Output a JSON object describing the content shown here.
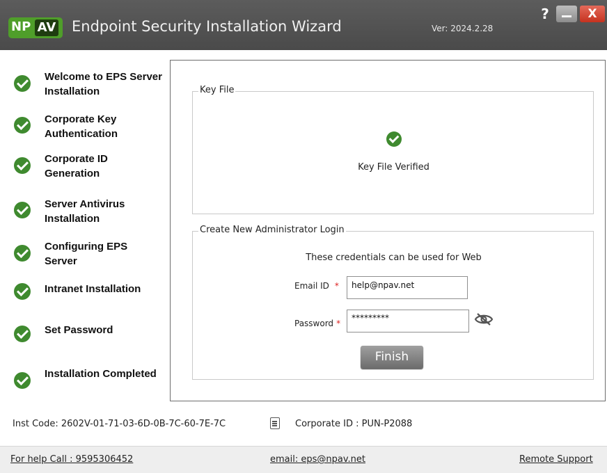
{
  "titlebar": {
    "logo_np": "NP",
    "logo_av": "AV",
    "title": "Endpoint Security Installation Wizard",
    "version": "Ver: 2024.2.28",
    "help_label": "?",
    "close_label": "X"
  },
  "steps": [
    {
      "label": "Welcome to EPS Server Installation",
      "status": "completed"
    },
    {
      "label": "Corporate Key Authentication",
      "status": "completed"
    },
    {
      "label": "Corporate ID Generation",
      "status": "completed"
    },
    {
      "label": "Server Antivirus Installation",
      "status": "completed"
    },
    {
      "label": "Configuring EPS Server",
      "status": "completed"
    },
    {
      "label": "Intranet Installation",
      "status": "completed"
    },
    {
      "label": "Set Password",
      "status": "completed"
    },
    {
      "label": "Installation Completed",
      "status": "completed"
    }
  ],
  "key_file": {
    "legend": "Key File",
    "status_text": "Key File Verified"
  },
  "admin_login": {
    "legend": "Create New Administrator Login",
    "note": "These credentials can be used for Web",
    "email_label": "Email ID",
    "email_value": "help@npav.net",
    "password_label": "Password",
    "password_value": "*********",
    "required_marker": "*",
    "finish_label": "Finish"
  },
  "info": {
    "inst_code": "Inst Code: 2602V-01-71-03-6D-0B-7C-60-7E-7C",
    "corporate_id": "Corporate ID : PUN-P2088"
  },
  "footer": {
    "help_call": "For help Call : 9595306452",
    "email": "email: eps@npav.net",
    "remote_support": "Remote Support"
  },
  "colors": {
    "titlebar": "#505050",
    "logo_green": "#4f9e2a",
    "check_green": "#3f8a2f",
    "close_red": "#c6321f",
    "required_red": "#d22222"
  }
}
